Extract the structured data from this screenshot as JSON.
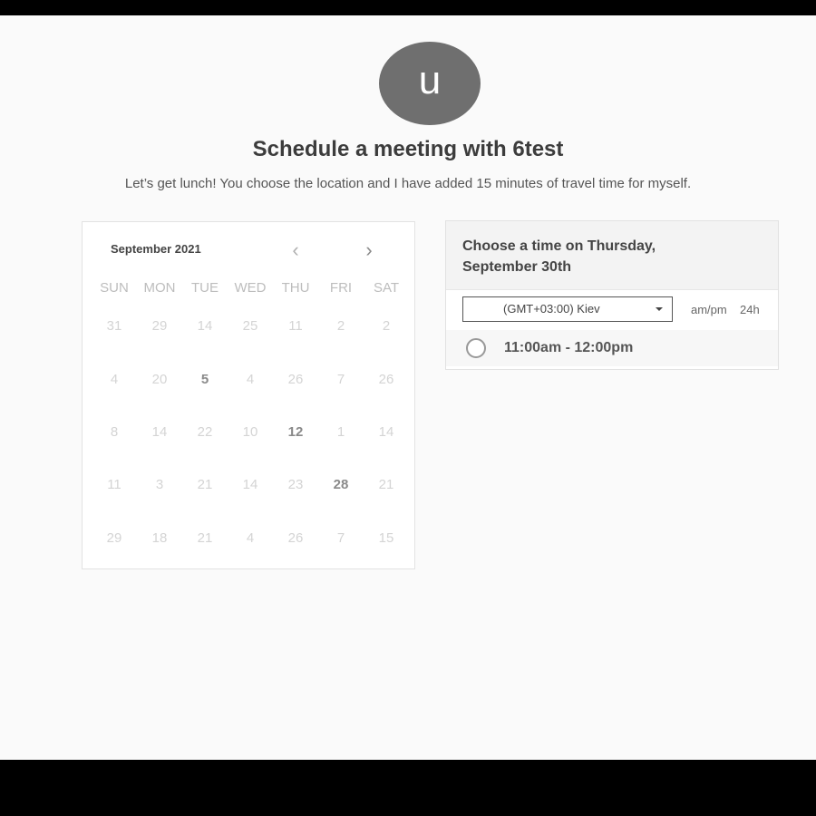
{
  "avatar": {
    "initial": "u"
  },
  "header": {
    "title": "Schedule a meeting with 6test",
    "description": "Let’s get lunch! You choose the location and I have added 15 minutes of travel time for myself."
  },
  "calendar": {
    "month_label": "September 2021",
    "prev_label": "‹",
    "next_label": "›",
    "weekdays": [
      "SUN",
      "MON",
      "TUE",
      "WED",
      "THU",
      "FRI",
      "SAT"
    ],
    "weeks": [
      [
        {
          "d": "31",
          "a": false
        },
        {
          "d": "29",
          "a": false
        },
        {
          "d": "14",
          "a": false
        },
        {
          "d": "25",
          "a": false
        },
        {
          "d": "11",
          "a": false
        },
        {
          "d": "2",
          "a": false
        },
        {
          "d": "2",
          "a": false
        }
      ],
      [
        {
          "d": "4",
          "a": false
        },
        {
          "d": "20",
          "a": false
        },
        {
          "d": "5",
          "a": true
        },
        {
          "d": "4",
          "a": false
        },
        {
          "d": "26",
          "a": false
        },
        {
          "d": "7",
          "a": false
        },
        {
          "d": "26",
          "a": false
        }
      ],
      [
        {
          "d": "8",
          "a": false
        },
        {
          "d": "14",
          "a": false
        },
        {
          "d": "22",
          "a": false
        },
        {
          "d": "10",
          "a": false
        },
        {
          "d": "12",
          "a": true
        },
        {
          "d": "1",
          "a": false
        },
        {
          "d": "14",
          "a": false
        }
      ],
      [
        {
          "d": "11",
          "a": false
        },
        {
          "d": "3",
          "a": false
        },
        {
          "d": "21",
          "a": false
        },
        {
          "d": "14",
          "a": false
        },
        {
          "d": "23",
          "a": false
        },
        {
          "d": "28",
          "a": true
        },
        {
          "d": "21",
          "a": false
        }
      ],
      [
        {
          "d": "29",
          "a": false
        },
        {
          "d": "18",
          "a": false
        },
        {
          "d": "21",
          "a": false
        },
        {
          "d": "4",
          "a": false
        },
        {
          "d": "26",
          "a": false
        },
        {
          "d": "7",
          "a": false
        },
        {
          "d": "15",
          "a": false
        }
      ]
    ]
  },
  "slots": {
    "heading": "Choose a time on Thursday, September 30th",
    "timezone": "(GMT+03:00) Kiev",
    "format_ampm": "am/pm",
    "format_24h": "24h",
    "items": [
      {
        "label": "11:00am - 12:00pm",
        "selected": false
      }
    ]
  }
}
